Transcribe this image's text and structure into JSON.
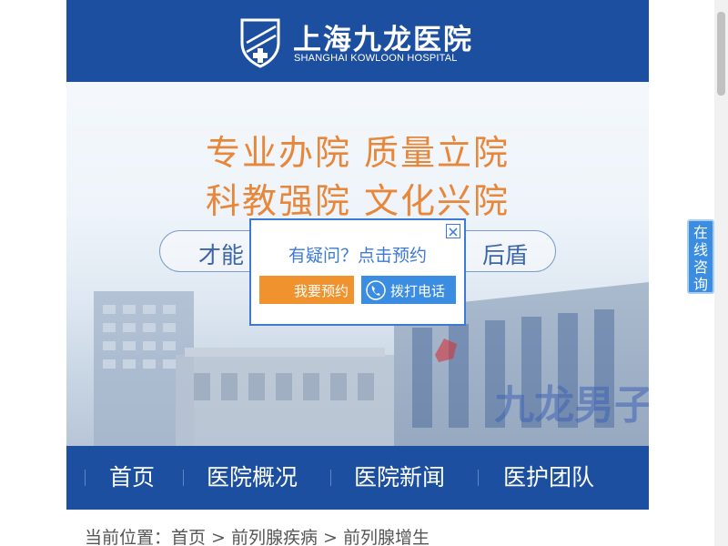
{
  "header": {
    "title_cn": "上海九龙医院",
    "title_en": "SHANGHAI KOWLOON HOSPITAL",
    "logo_icon": "shield-cross-icon"
  },
  "banner": {
    "slogan_line1": "专业办院  质量立院",
    "slogan_line2": "科教强院  文化兴院",
    "pill_left": "才能",
    "pill_right": "后盾",
    "building_sign": "九龙男子医院"
  },
  "popup": {
    "question": "有疑问？点击预约",
    "book_label": "我要预约",
    "call_label": "拨打电话"
  },
  "nav": {
    "items": [
      "首页",
      "医院概况",
      "医院新闻",
      "医护团队"
    ]
  },
  "breadcrumb": {
    "text": "当前位置：首页 > 前列腺疾病 > 前列腺增生"
  },
  "side_tab": {
    "label": "在线咨询"
  },
  "colors": {
    "brand_blue": "#1d4fa0",
    "slogan_orange": "#e8873a",
    "book_orange": "#f0932e",
    "call_blue": "#3a8de0"
  }
}
